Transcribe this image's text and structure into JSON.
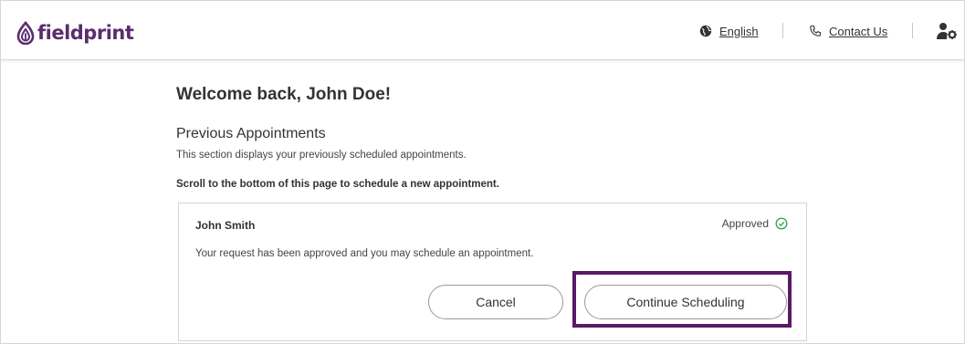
{
  "brand": {
    "name": "fieldprint",
    "color": "#5b2d6e"
  },
  "header": {
    "language_label": "English",
    "contact_label": "Contact Us",
    "icons": {
      "language": "globe-icon",
      "contact": "phone-icon",
      "account": "user-settings-icon"
    }
  },
  "main": {
    "welcome": "Welcome back, John Doe!",
    "section_title": "Previous Appointments",
    "section_description": "This section displays your previously scheduled appointments.",
    "scroll_note": "Scroll to the bottom of this page to schedule a new appointment."
  },
  "appointment": {
    "name": "John Smith",
    "status": "Approved",
    "status_color": "#3aa655",
    "message": "Your request has been approved and you may schedule an appointment.",
    "cancel_label": "Cancel",
    "continue_label": "Continue Scheduling"
  },
  "highlight_color": "#5b1a66"
}
